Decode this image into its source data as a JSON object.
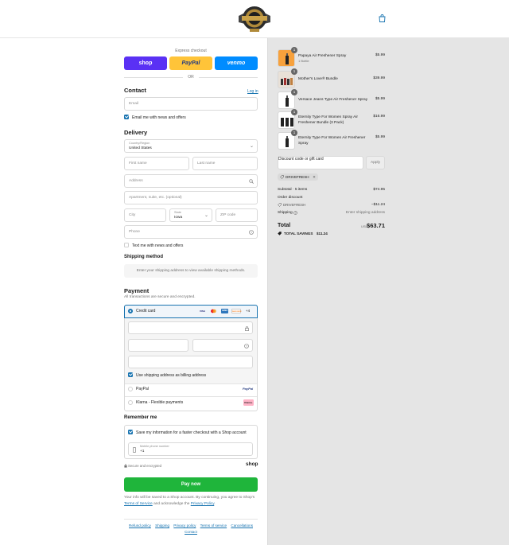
{
  "header": {
    "logo": "store-logo"
  },
  "express": {
    "title": "Express checkout",
    "shop_label": "shop",
    "paypal_label": "PayPal",
    "venmo_label": "venmo",
    "or": "OR"
  },
  "contact": {
    "title": "Contact",
    "login": "Log in",
    "email_placeholder": "Email",
    "news_label": "Email me with news and offers",
    "news_checked": true
  },
  "delivery": {
    "title": "Delivery",
    "country_label": "Country/Region",
    "country_value": "United States",
    "first_name": "First name",
    "last_name": "Last name",
    "address": "Address",
    "apartment": "Apartment, suite, etc. (optional)",
    "city": "City",
    "state_label": "State",
    "state_value": "Iowa",
    "zip": "ZIP code",
    "phone": "Phone",
    "text_label": "Text me with news and offers"
  },
  "shipping_method": {
    "title": "Shipping method",
    "note": "Enter your shipping address to view available shipping methods."
  },
  "payment": {
    "title": "Payment",
    "subtitle": "All transactions are secure and encrypted.",
    "credit_card": "Credit card",
    "card_logos": [
      "VISA",
      "MC",
      "AMEX",
      "DISCOVER"
    ],
    "more_cards": "+4",
    "billing_label": "Use shipping address as billing address",
    "paypal": "PayPal",
    "paypal_logo": "PayPal",
    "klarna": "Klarna - Flexible payments",
    "klarna_logo": "Klarna."
  },
  "remember": {
    "title": "Remember me",
    "save_label": "Save my information for a faster checkout with a Shop account",
    "mobile_label": "Mobile phone number",
    "mobile_value": "+1",
    "secure": "Secure and encrypted",
    "shop": "shop"
  },
  "pay_now": "Pay now",
  "legal": {
    "text1": "Your info will be saved to a Shop account. By continuing, you agree to Shop's",
    "tos": "Terms of Service",
    "text2": "and acknowledge the",
    "privacy": "Privacy Policy",
    "end": "."
  },
  "footer": [
    "Refund policy",
    "Shipping",
    "Privacy policy",
    "Terms of service",
    "Cancellations",
    "Contact"
  ],
  "items": [
    {
      "qty": "1",
      "name": "Papaya Air Freshener Spray",
      "variant": "1 Bottle",
      "price": "$5.99"
    },
    {
      "qty": "1",
      "name": "Mother's Love® Bundle",
      "variant": "",
      "price": "$39.99"
    },
    {
      "qty": "1",
      "name": "Versace Jeans Type Air Freshener Spray",
      "variant": "",
      "price": "$5.99"
    },
    {
      "qty": "1",
      "name": "Eternity Type For Women Spray Air Freshener Bundle (3 Pack)",
      "variant": "",
      "price": "$16.99"
    },
    {
      "qty": "1",
      "name": "Eternity Type For Women Air Freshener Spray",
      "variant": "",
      "price": "$5.99"
    }
  ],
  "discount": {
    "placeholder": "Discount code or gift card",
    "apply": "Apply",
    "code": "DRIVEFRESH"
  },
  "summary": {
    "subtotal_label": "Subtotal · 5 items",
    "subtotal": "$74.95",
    "order_discount": "Order discount",
    "discount_code": "DRIVEFRESH",
    "discount_value": "−$11.24",
    "shipping_label": "Shipping",
    "shipping_value": "Enter shipping address",
    "total_label": "Total",
    "currency": "USD",
    "total": "$63.71",
    "savings_label": "TOTAL SAVINGS",
    "savings": "$11.24"
  },
  "colors": {
    "accent": "#1773b0",
    "pay_button": "#1fb53b",
    "shop": "#5a31f4",
    "paypal": "#ffc439",
    "venmo": "#008cff"
  }
}
